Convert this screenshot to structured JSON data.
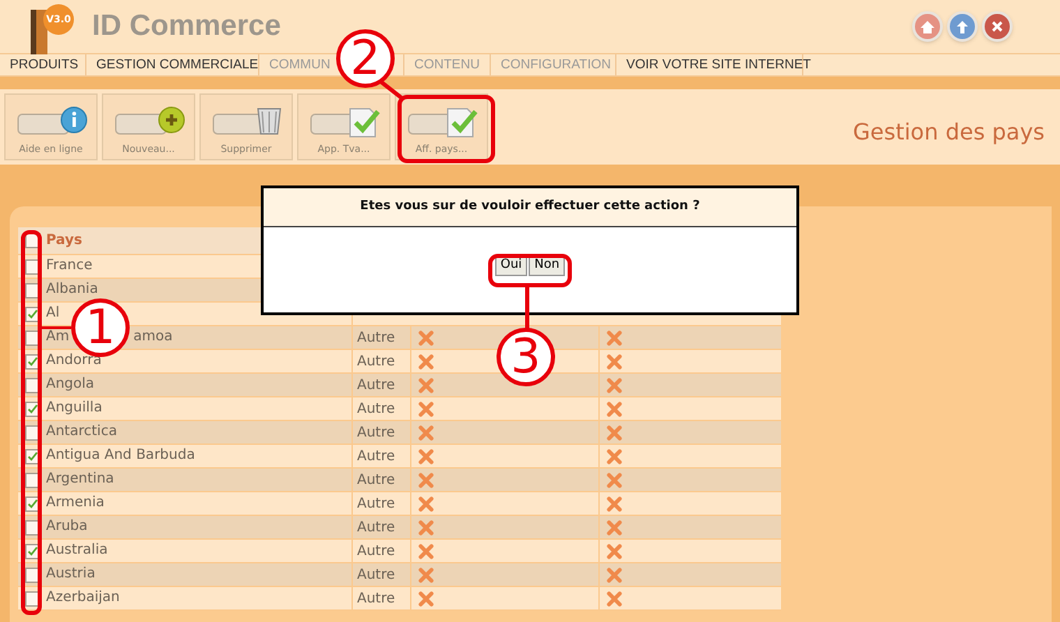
{
  "app": {
    "logo_badge": "V3.0",
    "title": "ID Commerce"
  },
  "nav": [
    "PRODUITS",
    "GESTION COMMERCIALE",
    "COMMUN",
    "CONTENU",
    "CONFIGURATION",
    "VOIR VOTRE SITE INTERNET"
  ],
  "toolbar": [
    {
      "label": "Aide en ligne",
      "kind": "info"
    },
    {
      "label": "Nouveau...",
      "kind": "add"
    },
    {
      "label": "Supprimer",
      "kind": "trash"
    },
    {
      "label": "App. Tva...",
      "kind": "check"
    },
    {
      "label": "Aff. pays...",
      "kind": "check"
    }
  ],
  "page_title": "Gestion des pays",
  "table": {
    "header": {
      "label": "Pays",
      "checked": false
    },
    "rows": [
      {
        "name": "France",
        "checked": false
      },
      {
        "name": "Albania",
        "checked": false
      },
      {
        "name": "Al",
        "checked": true
      },
      {
        "name": "Am",
        "name_after": "amoa",
        "checked": false,
        "type": "Autre"
      },
      {
        "name": "Andorra",
        "checked": true,
        "type": "Autre"
      },
      {
        "name": "Angola",
        "checked": false,
        "type": "Autre"
      },
      {
        "name": "Anguilla",
        "checked": true,
        "type": "Autre"
      },
      {
        "name": "Antarctica",
        "checked": false,
        "type": "Autre"
      },
      {
        "name": "Antigua And Barbuda",
        "checked": true,
        "type": "Autre"
      },
      {
        "name": "Argentina",
        "checked": false,
        "type": "Autre"
      },
      {
        "name": "Armenia",
        "checked": true,
        "type": "Autre"
      },
      {
        "name": "Aruba",
        "checked": false,
        "type": "Autre"
      },
      {
        "name": "Australia",
        "checked": true,
        "type": "Autre"
      },
      {
        "name": "Austria",
        "checked": false,
        "type": "Autre"
      },
      {
        "name": "Azerbaijan",
        "checked": false,
        "type": "Autre"
      }
    ]
  },
  "dialog": {
    "message": "Etes vous sur de vouloir effectuer cette action ?",
    "buttons": [
      "Oui",
      "Non"
    ]
  },
  "annotations": [
    "1",
    "2",
    "3"
  ]
}
